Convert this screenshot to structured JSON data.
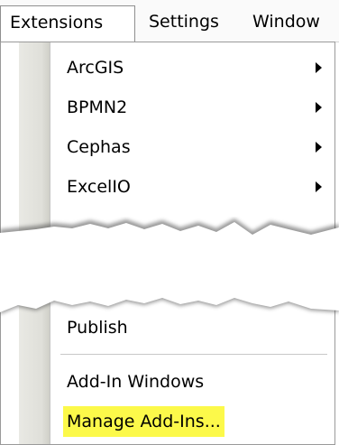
{
  "menubar": {
    "items": [
      "Extensions",
      "Settings",
      "Window"
    ]
  },
  "menu": {
    "items": [
      {
        "label": "ArcGIS",
        "submenu": true
      },
      {
        "label": "BPMN2",
        "submenu": true
      },
      {
        "label": "Cephas",
        "submenu": true
      },
      {
        "label": "ExcelIO",
        "submenu": true
      }
    ],
    "after_tear": [
      {
        "label": "Publish"
      }
    ],
    "bottom": [
      {
        "label": "Add-In Windows"
      },
      {
        "label": "Manage Add-Ins...",
        "highlighted": true
      }
    ]
  },
  "colors": {
    "highlight": "#fcf94a"
  }
}
